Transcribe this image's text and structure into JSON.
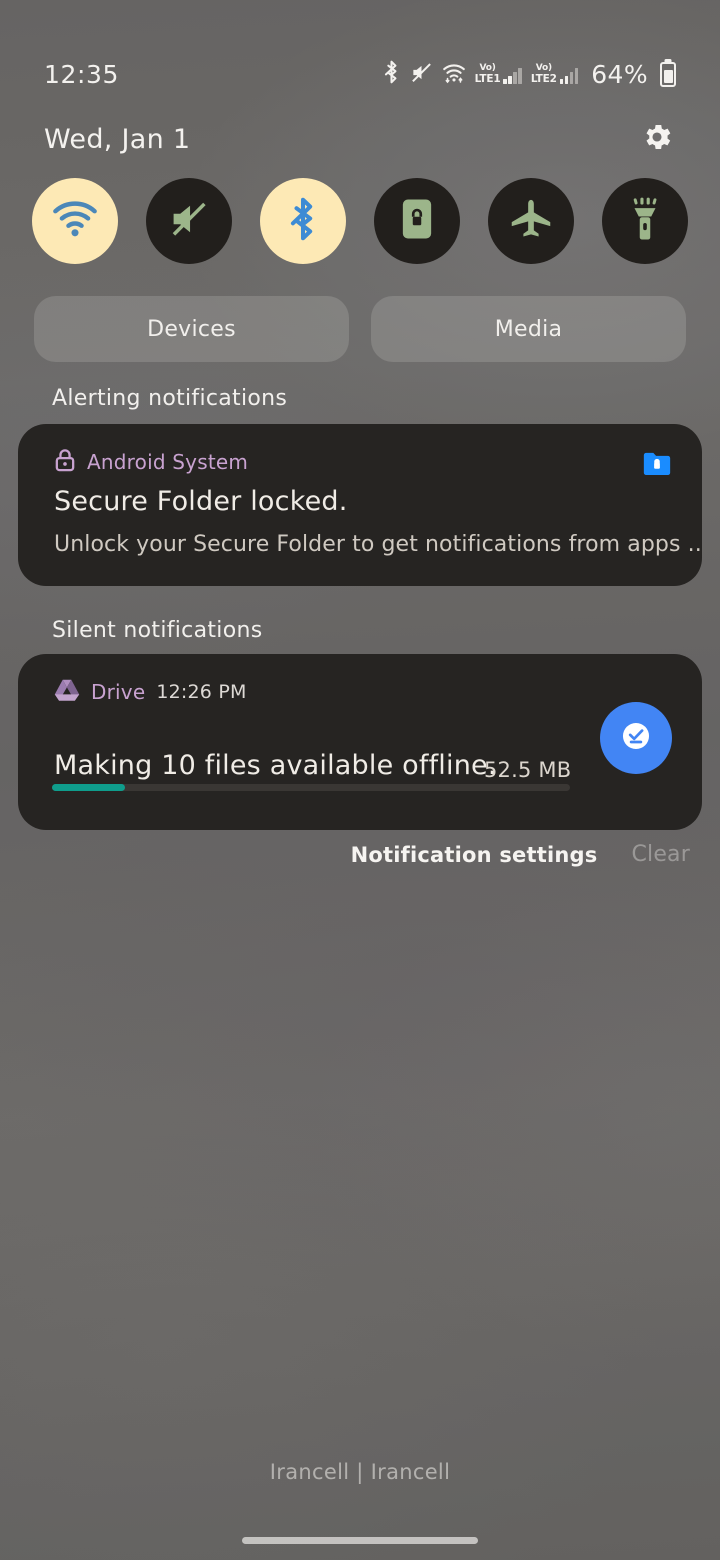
{
  "status_bar": {
    "clock": "12:35",
    "battery_percent": "64%",
    "icons": [
      "bluetooth-icon",
      "mute-icon",
      "wifi-icon",
      "volte-sim1-icon",
      "signal-sim1-icon",
      "volte-sim2-icon",
      "signal-sim2-icon",
      "battery-icon"
    ],
    "sim1": {
      "volte": "Vo)",
      "network": "LTE1"
    },
    "sim2": {
      "volte": "Vo)",
      "network": "LTE2"
    }
  },
  "shade": {
    "date": "Wed, Jan 1",
    "settings_icon": "gear-icon"
  },
  "quick_settings": {
    "tiles": [
      {
        "name": "wifi",
        "label": "Wi-Fi",
        "icon": "wifi-icon",
        "state": "on"
      },
      {
        "name": "sound",
        "label": "Mute",
        "icon": "volume-mute-icon",
        "state": "off"
      },
      {
        "name": "bluetooth",
        "label": "Bluetooth",
        "icon": "bluetooth-icon",
        "state": "on"
      },
      {
        "name": "auto-rotate",
        "label": "Auto rotate",
        "icon": "rotation-lock-icon",
        "state": "off"
      },
      {
        "name": "airplane-mode",
        "label": "Airplane mode",
        "icon": "airplane-icon",
        "state": "off"
      },
      {
        "name": "flashlight",
        "label": "Flashlight",
        "icon": "flashlight-icon",
        "state": "off"
      }
    ],
    "pills": [
      {
        "name": "devices",
        "label": "Devices"
      },
      {
        "name": "media",
        "label": "Media"
      }
    ],
    "colors": {
      "tile_on_bg": "#fde9b5",
      "tile_off_bg": "#221f1c",
      "icon_on": "#4b87b8",
      "icon_off": "#9cb58a"
    }
  },
  "notifications": {
    "alerting_header": "Alerting notifications",
    "silent_header": "Silent notifications",
    "secure_folder": {
      "app_name": "Android System",
      "app_icon": "lock-icon",
      "right_icon": "secure-folder-icon",
      "title": "Secure Folder locked.",
      "body": "Unlock your Secure Folder to get notifications from apps .."
    },
    "drive": {
      "app_name": "Drive",
      "app_icon": "google-drive-icon",
      "time": "12:26 PM",
      "title": "Making 10 files available offline.",
      "size": "52.5 MB",
      "action_icon": "offline-available-icon",
      "progress_percent": 14,
      "progress_color": "#0f9d8c"
    },
    "footer": {
      "settings_label": "Notification settings",
      "clear_label": "Clear"
    }
  },
  "footer": {
    "carrier": "Irancell | Irancell",
    "gesture_bar": "home-gesture-bar"
  }
}
